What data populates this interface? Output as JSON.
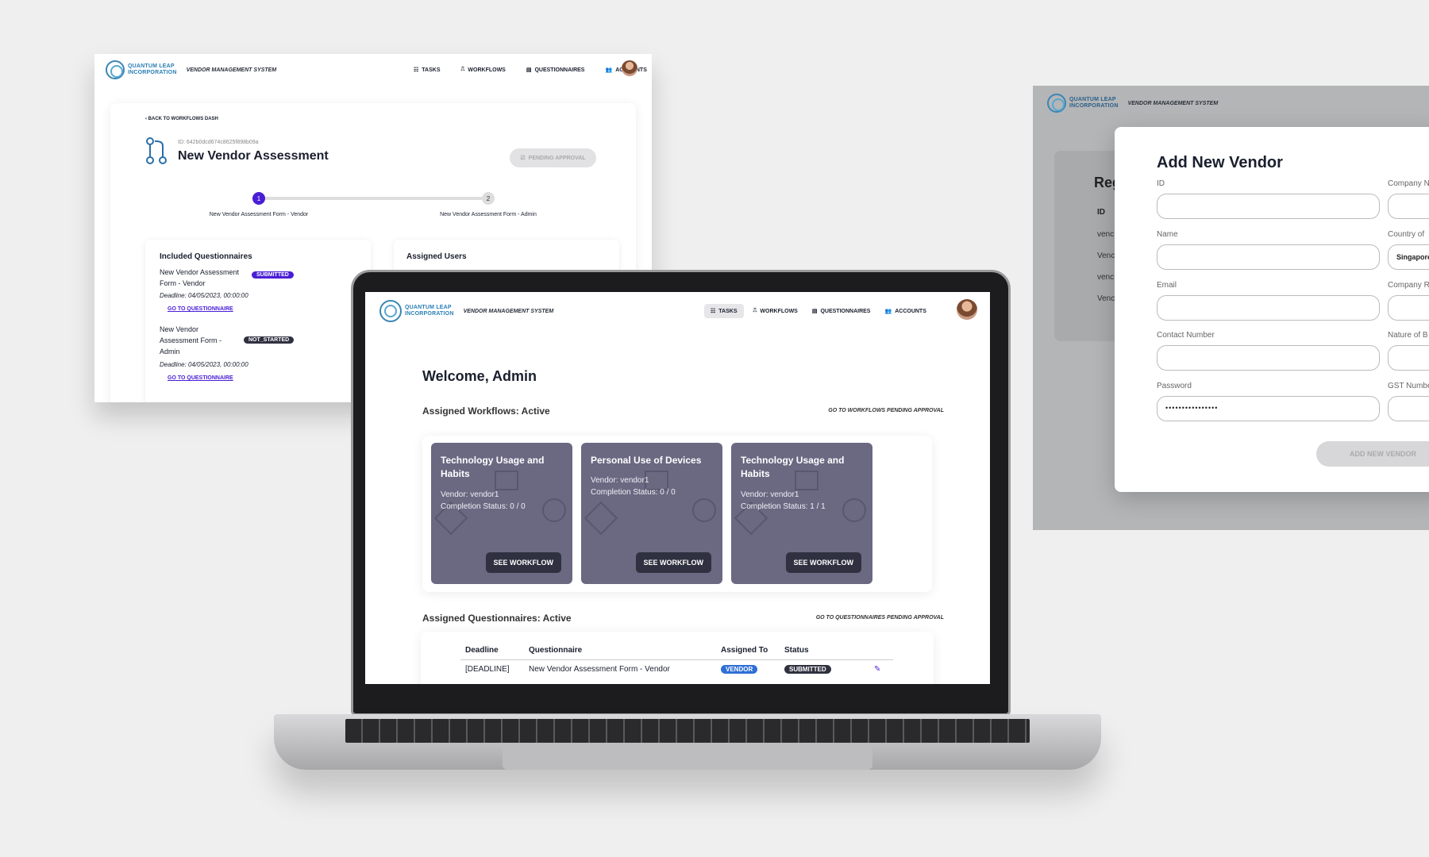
{
  "brand": {
    "logo_line1": "QUANTUM LEAP",
    "logo_line2": "INCORPORATION",
    "app_name": "VENDOR MANAGEMENT SYSTEM"
  },
  "nav": {
    "tasks": "TASKS",
    "workflows": "WORKFLOWS",
    "questionnaires": "QUESTIONNAIRES",
    "accounts": "ACCOUNTS"
  },
  "workflow_view": {
    "back": "‹ BACK TO WORKFLOWS DASH",
    "id": "ID: 642b0dcd674c8625f898b09a",
    "title": "New Vendor Assessment",
    "status_button": "PENDING APPROVAL",
    "steps": [
      {
        "num": "1",
        "label": "New Vendor Assessment Form - Vendor"
      },
      {
        "num": "2",
        "label": "New Vendor Assessment Form - Admin"
      }
    ],
    "included_title": "Included Questionnaires",
    "assigned_title": "Assigned Users",
    "questionnaires": [
      {
        "name": "New Vendor Assessment Form - Vendor",
        "status": "SUBMITTED",
        "deadline": "Deadline: 04/05/2023, 00:00:00",
        "link": "GO TO QUESTIONNAIRE"
      },
      {
        "name": "New Vendor Assessment Form - Admin",
        "status": "NOT_STARTED",
        "deadline": "Deadline: 04/05/2023, 00:00:00",
        "link": "GO TO QUESTIONNAIRE"
      }
    ]
  },
  "dashboard": {
    "welcome": "Welcome, Admin",
    "workflows_title": "Assigned Workflows: Active",
    "workflows_link": "GO TO WORKFLOWS PENDING APPROVAL",
    "workflows": [
      {
        "title": "Technology Usage and Habits",
        "vendor": "Vendor: vendor1",
        "completion": "Completion Status: 0 / 0",
        "button": "SEE WORKFLOW"
      },
      {
        "title": "Personal Use of Devices",
        "vendor": "Vendor: vendor1",
        "completion": "Completion Status: 0 / 0",
        "button": "SEE WORKFLOW"
      },
      {
        "title": "Technology Usage and Habits",
        "vendor": "Vendor: vendor1",
        "completion": "Completion Status: 1 / 1",
        "button": "SEE WORKFLOW"
      }
    ],
    "questionnaires_title": "Assigned Questionnaires: Active",
    "questionnaires_link": "GO TO QUESTIONNAIRES PENDING APPROVAL",
    "table_headers": [
      "Deadline",
      "Questionnaire",
      "Assigned To",
      "Status"
    ],
    "rows": [
      {
        "deadline": "[DEADLINE]",
        "questionnaire": "New Vendor Assessment Form - Vendor",
        "assigned": "VENDOR",
        "status": "SUBMITTED"
      }
    ]
  },
  "add_vendor": {
    "title": "Add New Vendor",
    "bg_heading": "Reg",
    "bg_col": "ID",
    "bg_rows": [
      "venc",
      "Venc",
      "venc",
      "Venc"
    ],
    "fields_left": [
      {
        "label": "ID",
        "value": ""
      },
      {
        "label": "Name",
        "value": ""
      },
      {
        "label": "Email",
        "value": ""
      },
      {
        "label": "Contact Number",
        "value": ""
      },
      {
        "label": "Password",
        "value": "••••••••••••••••"
      }
    ],
    "fields_right": [
      {
        "label": "Company N",
        "value": ""
      },
      {
        "label": "Country of",
        "value": "Singapore"
      },
      {
        "label": "Company R",
        "value": ""
      },
      {
        "label": "Nature of B",
        "value": ""
      },
      {
        "label": "GST Numbe",
        "value": ""
      }
    ],
    "submit": "ADD NEW VENDOR"
  }
}
